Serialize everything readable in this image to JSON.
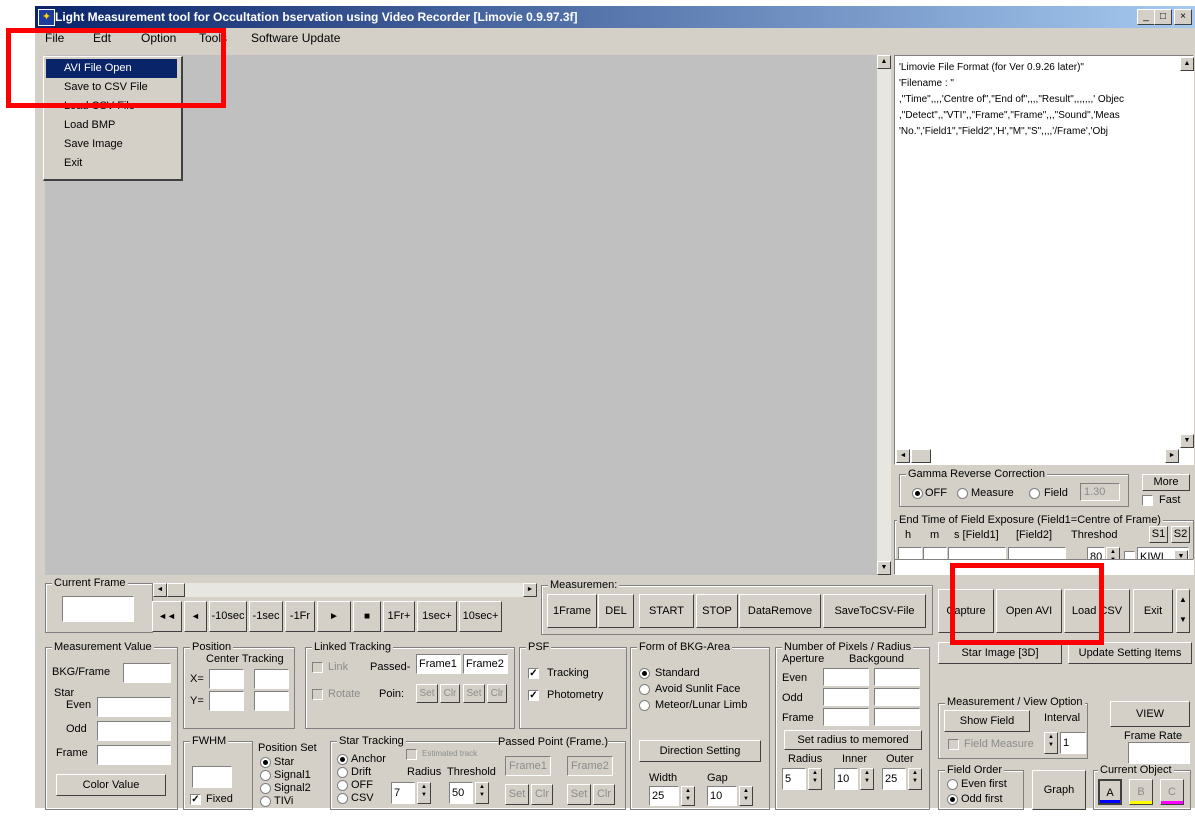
{
  "window": {
    "title": "Light Measurement tool for Occultation bservation using Video Recorder [Limovie 0.9.97.3f]",
    "minimize": "_",
    "maximize": "□",
    "close": "×"
  },
  "menubar": {
    "items": [
      "File",
      "Edt",
      "Option",
      "Tools",
      "Software Update"
    ]
  },
  "file_menu": {
    "items": [
      "AVI File Open",
      "Save to CSV File",
      "Load CSV File",
      "Load BMP",
      "Save Image",
      "Exit"
    ]
  },
  "text_panel": {
    "lines": [
      "'Limovie File Format (for Ver 0.9.26 later)\"",
      "'Filename : \"",
      ",\"Time\",,,,'Centre of\",\"End of\",,,,\"Result\",,,,,,,' Objec",
      ",\"Detect\",,\"VTI\",,\"Frame\",\"Frame\",,,\"Sound\",'Meas",
      "'No.\",'Field1\",\"Field2\",'H',\"M\",\"S\",,,,'/Frame','Obj"
    ]
  },
  "gamma": {
    "title": "Gamma Reverse Correction",
    "options": [
      "OFF",
      "Measure",
      "Field"
    ],
    "value": "1.30",
    "more": "More",
    "fast": "Fast"
  },
  "exposure": {
    "title": "End Time of Field Exposure (Field1=Centre of Frame)",
    "labels": [
      "h",
      "m",
      "s [Field1]",
      "[Field2]",
      "Threshod"
    ],
    "s1": "S1",
    "s2": "S2",
    "threshold": "80",
    "kiwi": "KIWI"
  },
  "current_frame": {
    "label": "Current Frame",
    "value": ""
  },
  "playback": {
    "buttons": [
      "◄◄",
      "◄",
      "-10sec",
      "-1sec",
      "-1Fr",
      "►",
      "■",
      "1Fr+",
      "1sec+",
      "10sec+"
    ]
  },
  "measurement": {
    "label": "Measuremen:",
    "buttons": [
      "1Frame",
      "DEL",
      "START",
      "STOP",
      "DataRemove",
      "SaveToCSV-File"
    ]
  },
  "right_buttons": [
    "Capture",
    "Open AVI",
    "Load CSV",
    "Exit"
  ],
  "measurement_value": {
    "title": "Measurement Value",
    "labels": [
      "BKG/Frame",
      "Star",
      "Even",
      "Odd",
      "Frame"
    ],
    "color_button": "Color Value"
  },
  "position": {
    "title": "Position",
    "sub": "Center Tracking",
    "x": "X=",
    "y": "Y="
  },
  "fwhm": {
    "title": "FWHM",
    "fixed": "Fixed"
  },
  "position_set": {
    "title": "Position Set",
    "options": [
      "Star",
      "Signal1",
      "Signal2",
      "TIVi"
    ]
  },
  "linked_tracking": {
    "title": "Linked Tracking",
    "link": "Link",
    "passed": "Passed-",
    "frame1": "Frame1",
    "frame2": "Frame2",
    "rotate": "Rotate",
    "point": "Poin:",
    "buttons": [
      "Set",
      "Clr",
      "Set",
      "Clr"
    ]
  },
  "star_tracking": {
    "title": "Star Tracking",
    "options": [
      "Anchor",
      "Drift",
      "OFF",
      "CSV"
    ],
    "estimated": "Estimated track",
    "radius": "Radius",
    "threshold": "Threshold",
    "radius_value": "7",
    "threshold_value": "50",
    "passed_point": "Passed Point (Frame.)",
    "frame1": "Frame1",
    "frame2": "Frame2",
    "buttons": [
      "Set",
      "Clr",
      "Set",
      "Clr"
    ]
  },
  "psf": {
    "title": "PSF",
    "tracking": "Tracking",
    "photometry": "Photometry"
  },
  "bkg_area": {
    "title": "Form of BKG-Area",
    "options": [
      "Standard",
      "Avoid Sunlit Face",
      "Meteor/Lunar Limb"
    ],
    "direction_button": "Direction Setting",
    "width_label": "Width",
    "gap_label": "Gap",
    "width": "25",
    "gap": "10"
  },
  "pixels": {
    "title": "Number of Pixels / Radius",
    "aperture": "Aperture",
    "background": "Backgound",
    "rows": [
      "Even",
      "Odd",
      "Frame"
    ],
    "set_radius": "Set radius to memored",
    "radius_label": "Radius",
    "inner_label": "Inner",
    "outer_label": "Outer",
    "radius": "5",
    "inner": "10",
    "outer": "25"
  },
  "right_panel": {
    "star_image": "Star Image [3D]",
    "update": "Update Setting Items",
    "mv_title": "Measurement / View Option",
    "show_field": "Show Field",
    "interval": "Interval",
    "interval_value": "1",
    "field_measure": "Field Measure",
    "view": "VIEW",
    "frame_rate": "Frame Rate",
    "field_order": "Field Order",
    "even_first": "Even first",
    "odd_first": "Odd first",
    "graph": "Graph",
    "current_object": "Current Object",
    "objects": [
      "A",
      "B",
      "C"
    ],
    "object_colors": [
      "#0000ff",
      "#ffff00",
      "#ff00ff"
    ]
  }
}
